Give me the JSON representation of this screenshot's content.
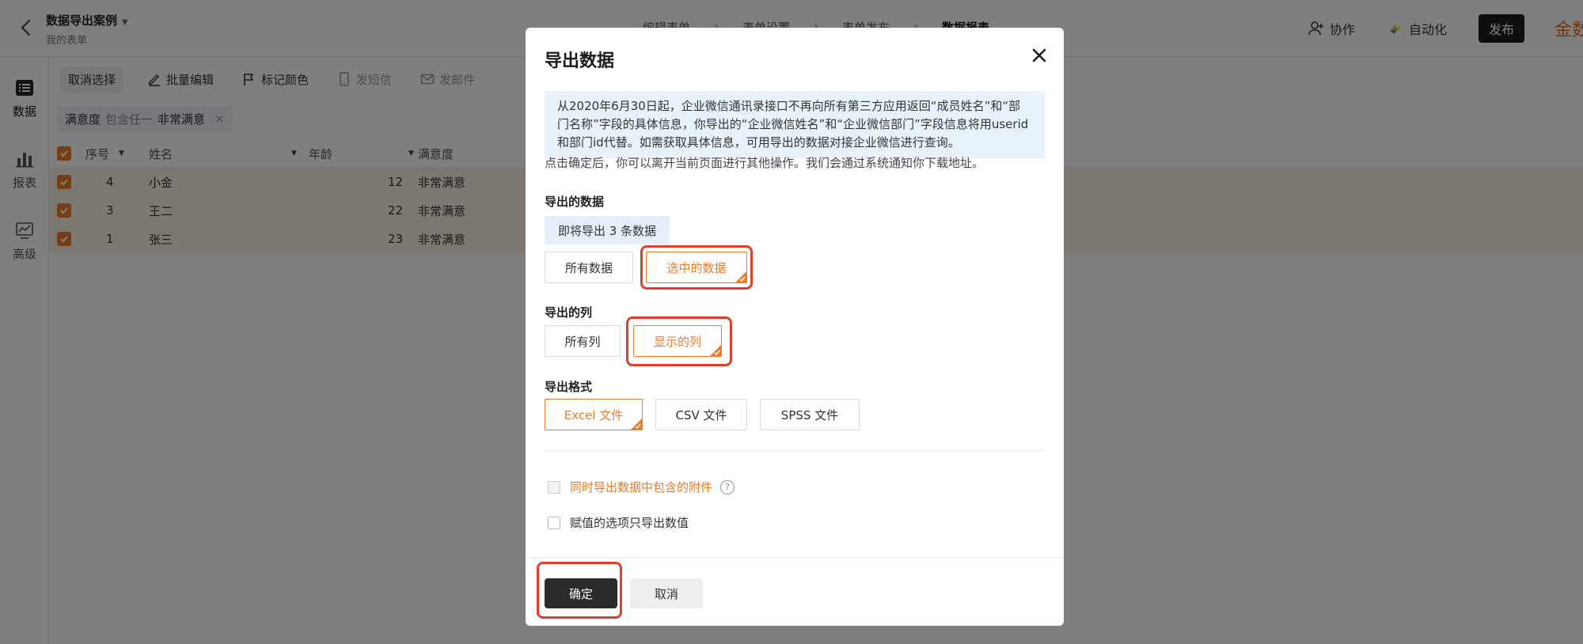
{
  "header": {
    "form_title": "数据导出案例",
    "form_subtitle": "我的表单",
    "steps": [
      "编辑表单",
      "表单设置",
      "表单发布",
      "数据报表"
    ],
    "collab": "协作",
    "automation": "自动化",
    "publish": "发布",
    "brand": "金数"
  },
  "sidebar": {
    "items": [
      {
        "label": "数据",
        "icon": "list-icon"
      },
      {
        "label": "报表",
        "icon": "bar-chart-icon"
      },
      {
        "label": "高级",
        "icon": "trend-icon"
      }
    ]
  },
  "toolbar": {
    "cancel_select": "取消选择",
    "bulk_edit": "批量编辑",
    "mark_color": "标记颜色",
    "send_sms": "发短信",
    "send_email": "发邮件"
  },
  "filter": {
    "field": "满意度",
    "op": "包含任一",
    "value": "非常满意",
    "remove": "×"
  },
  "table": {
    "headers": [
      "序号",
      "姓名",
      "年龄",
      "满意度"
    ],
    "rows": [
      {
        "id": "4",
        "name": "小金",
        "age": "12",
        "satisfaction": "非常满意"
      },
      {
        "id": "3",
        "name": "王二",
        "age": "22",
        "satisfaction": "非常满意"
      },
      {
        "id": "1",
        "name": "张三",
        "age": "23",
        "satisfaction": "非常满意"
      }
    ]
  },
  "modal": {
    "title": "导出数据",
    "notice": "从2020年6月30日起，企业微信通讯录接口不再向所有第三方应用返回“成员姓名”和“部门名称”字段的具体信息，你导出的“企业微信姓名”和“企业微信部门”字段信息将用userid和部门id代替。如需获取具体信息，可用导出的数据对接企业微信进行查询。",
    "hint": "点击确定后，你可以离开当前页面进行其他操作。我们会通过系统通知你下载地址。",
    "data_label": "导出的数据",
    "count_text": "即将导出 3 条数据",
    "data_options": [
      "所有数据",
      "选中的数据"
    ],
    "column_label": "导出的列",
    "column_options": [
      "所有列",
      "显示的列"
    ],
    "format_label": "导出格式",
    "format_options": [
      "Excel 文件",
      "CSV 文件",
      "SPSS 文件"
    ],
    "attach_label": "同时导出数据中包含的附件",
    "help": "?",
    "value_only_label": "赋值的选项只导出数值",
    "confirm": "确定",
    "cancel": "取消"
  },
  "colors": {
    "accent": "#ef7a27",
    "highlight_box": "#e33c2a",
    "dark_button": "#2b2b2b",
    "notice_bg": "#e8f2fd"
  }
}
